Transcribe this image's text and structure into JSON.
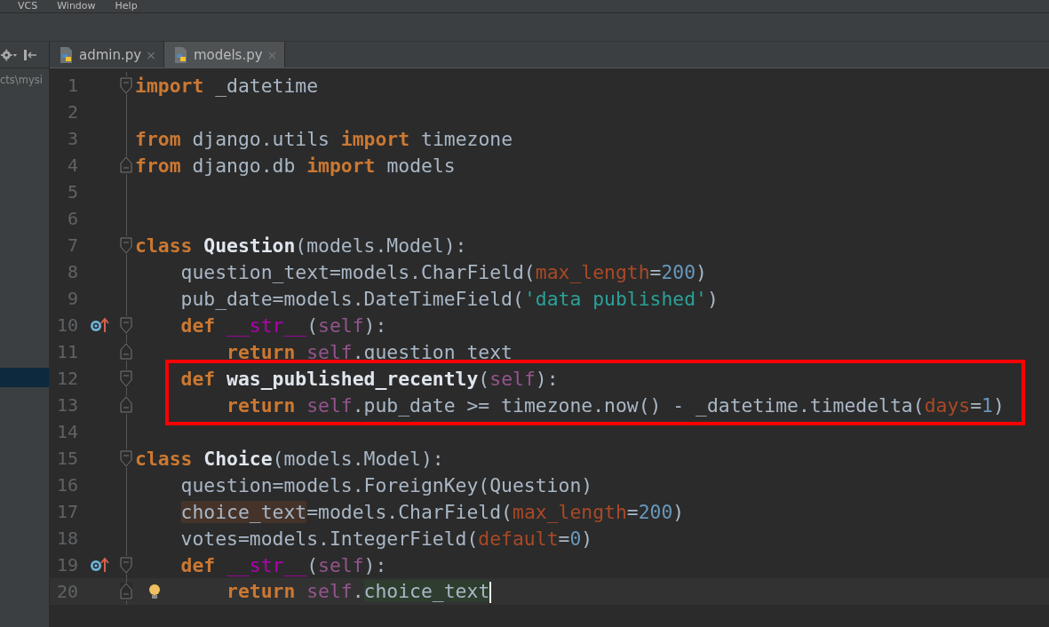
{
  "menu_bar": {
    "items": [
      "VCS",
      "Window",
      "Help"
    ]
  },
  "project_panel": {
    "path_fragment": "cts\\mysi",
    "selection_bar": true
  },
  "tabs": [
    {
      "label": "admin.py",
      "selected": false,
      "close": "×"
    },
    {
      "label": "models.py",
      "selected": true,
      "close": "×"
    }
  ],
  "editor": {
    "lines": [
      {
        "number": "1",
        "fold_start": true,
        "tokens": [
          {
            "kind": "keyword",
            "text": "import"
          },
          {
            "kind": "plain",
            "text": " _datetime"
          }
        ]
      },
      {
        "number": "2"
      },
      {
        "number": "3",
        "tokens": [
          {
            "kind": "keyword",
            "text": "from"
          },
          {
            "kind": "plain",
            "text": " django.utils "
          },
          {
            "kind": "keyword",
            "text": "import"
          },
          {
            "kind": "plain",
            "text": " timezone"
          }
        ]
      },
      {
        "number": "4",
        "fold_end": true,
        "tokens": [
          {
            "kind": "keyword",
            "text": "from"
          },
          {
            "kind": "plain",
            "text": " django.db "
          },
          {
            "kind": "keyword",
            "text": "import"
          },
          {
            "kind": "plain",
            "text": " models"
          }
        ]
      },
      {
        "number": "5"
      },
      {
        "number": "6"
      },
      {
        "number": "7",
        "fold_start": true,
        "tokens": [
          {
            "kind": "keyword",
            "text": "class "
          },
          {
            "kind": "name",
            "text": "Question"
          },
          {
            "kind": "plain",
            "text": "(models.Model):"
          }
        ]
      },
      {
        "number": "8",
        "tokens": [
          {
            "kind": "plain",
            "text": "    question_text=models.CharField("
          },
          {
            "kind": "param",
            "text": "max_length"
          },
          {
            "kind": "plain",
            "text": "="
          },
          {
            "kind": "number",
            "text": "200"
          },
          {
            "kind": "plain",
            "text": ")"
          }
        ]
      },
      {
        "number": "9",
        "tokens": [
          {
            "kind": "plain",
            "text": "    pub_date=models.DateTimeField("
          },
          {
            "kind": "string",
            "text": "'data published'"
          },
          {
            "kind": "plain",
            "text": ")"
          }
        ]
      },
      {
        "number": "10",
        "fold_start": true,
        "override": true,
        "tokens": [
          {
            "kind": "keyword",
            "text": "    def "
          },
          {
            "kind": "magic",
            "text": "__str__"
          },
          {
            "kind": "plain",
            "text": "("
          },
          {
            "kind": "self",
            "text": "self"
          },
          {
            "kind": "plain",
            "text": "):"
          }
        ]
      },
      {
        "number": "11",
        "fold_end": true,
        "tokens": [
          {
            "kind": "keyword",
            "text": "        return "
          },
          {
            "kind": "self",
            "text": "self"
          },
          {
            "kind": "plain",
            "text": ".question_text"
          }
        ]
      },
      {
        "number": "12",
        "fold_start": true,
        "boxed": true,
        "tokens": [
          {
            "kind": "keyword",
            "text": "    def "
          },
          {
            "kind": "name",
            "text": "was_published_recently"
          },
          {
            "kind": "plain",
            "text": "("
          },
          {
            "kind": "self",
            "text": "self"
          },
          {
            "kind": "plain",
            "text": "):"
          }
        ]
      },
      {
        "number": "13",
        "fold_end": true,
        "boxed": true,
        "tokens": [
          {
            "kind": "keyword",
            "text": "        return "
          },
          {
            "kind": "self",
            "text": "self"
          },
          {
            "kind": "plain",
            "text": ".pub_date >= timezone.now() - _datetime.timedelta("
          },
          {
            "kind": "param",
            "text": "days"
          },
          {
            "kind": "plain",
            "text": "="
          },
          {
            "kind": "number",
            "text": "1"
          },
          {
            "kind": "plain",
            "text": ")"
          }
        ]
      },
      {
        "number": "14"
      },
      {
        "number": "15",
        "fold_start": true,
        "tokens": [
          {
            "kind": "keyword",
            "text": "class "
          },
          {
            "kind": "name",
            "text": "Choice"
          },
          {
            "kind": "plain",
            "text": "(models.Model):"
          }
        ]
      },
      {
        "number": "16",
        "tokens": [
          {
            "kind": "plain",
            "text": "    question=models.ForeignKey(Question)"
          }
        ]
      },
      {
        "number": "17",
        "tokens": [
          {
            "kind": "written",
            "text": "    choice_text"
          },
          {
            "kind": "plain",
            "text": "=models.CharField("
          },
          {
            "kind": "param",
            "text": "max_length"
          },
          {
            "kind": "plain",
            "text": "="
          },
          {
            "kind": "number",
            "text": "200"
          },
          {
            "kind": "plain",
            "text": ")"
          }
        ]
      },
      {
        "number": "18",
        "tokens": [
          {
            "kind": "plain",
            "text": "    votes=models.IntegerField("
          },
          {
            "kind": "param",
            "text": "default"
          },
          {
            "kind": "plain",
            "text": "="
          },
          {
            "kind": "number",
            "text": "0"
          },
          {
            "kind": "plain",
            "text": ")"
          }
        ]
      },
      {
        "number": "19",
        "fold_start": true,
        "override": true,
        "tokens": [
          {
            "kind": "keyword",
            "text": "    def "
          },
          {
            "kind": "magic",
            "text": "__str__"
          },
          {
            "kind": "plain",
            "text": "("
          },
          {
            "kind": "self",
            "text": "self"
          },
          {
            "kind": "plain",
            "text": "):"
          }
        ]
      },
      {
        "number": "20",
        "fold_end": true,
        "bulb": true,
        "current": true,
        "caret": true,
        "tokens": [
          {
            "kind": "keyword",
            "text": "        return "
          },
          {
            "kind": "self",
            "text": "self"
          },
          {
            "kind": "plain",
            "text": "."
          },
          {
            "kind": "read",
            "text": "choice_text"
          }
        ]
      }
    ]
  }
}
